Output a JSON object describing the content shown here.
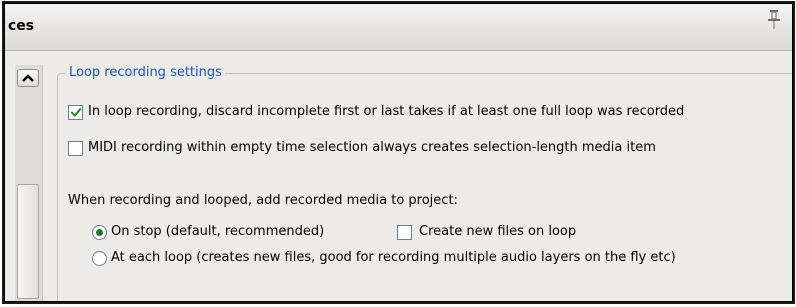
{
  "window": {
    "title": "ces",
    "pin_icon": "pin-icon"
  },
  "scrollbar": {
    "up_icon": "chevron-up-icon"
  },
  "loop_group": {
    "legend": "Loop recording settings",
    "discard_takes": {
      "label": "In loop recording, discard incomplete first or last takes if at least one full loop was recorded",
      "checked": true
    },
    "midi_selection_length": {
      "label": "MIDI recording within empty time selection always creates selection-length media item",
      "checked": false
    },
    "add_media_heading": "When recording and looped, add recorded media to project:",
    "options": [
      {
        "label": "On stop (default, recommended)",
        "selected": true
      },
      {
        "label": "At each loop (creates new files, good for recording multiple audio layers on the fly etc)",
        "selected": false
      }
    ],
    "create_new_files": {
      "label": "Create new files on loop",
      "checked": false
    }
  },
  "colors": {
    "accent_legend": "#1c56c7",
    "check_green": "#1a8a1a",
    "panel_bg": "#ecebe8"
  }
}
